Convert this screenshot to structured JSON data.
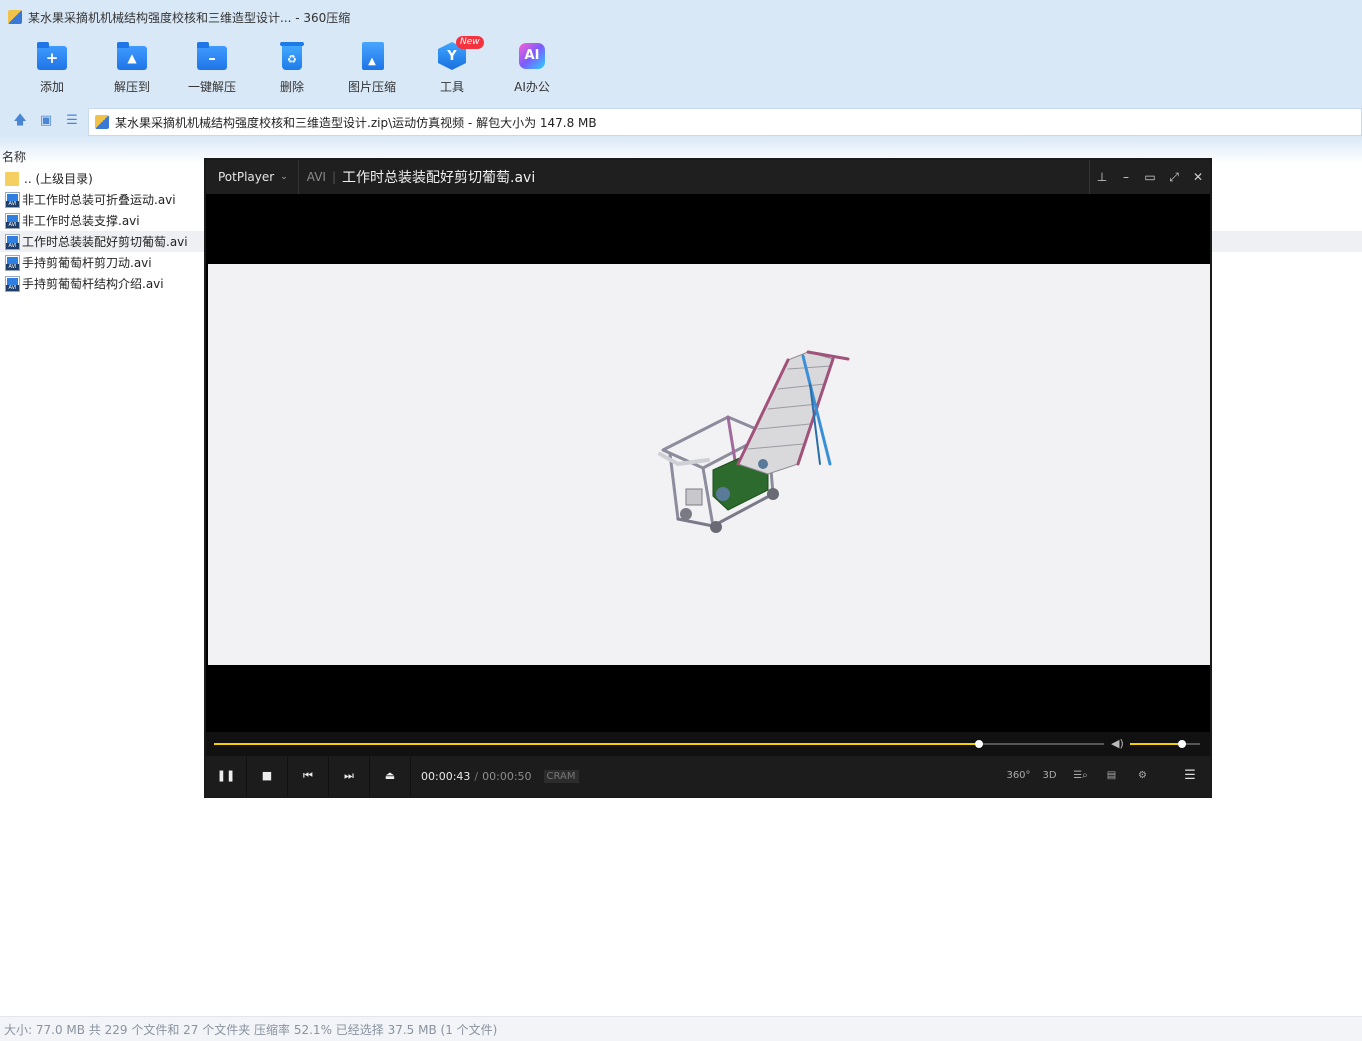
{
  "window": {
    "title": "某水果采摘机机械结构强度校核和三维造型设计... - 360压缩"
  },
  "toolbar": {
    "items": [
      {
        "label": "添加",
        "icon": "add-icon"
      },
      {
        "label": "解压到",
        "icon": "extract-to-icon"
      },
      {
        "label": "一键解压",
        "icon": "one-click-extract-icon"
      },
      {
        "label": "删除",
        "icon": "delete-icon"
      },
      {
        "label": "图片压缩",
        "icon": "image-compress-icon"
      },
      {
        "label": "工具",
        "icon": "tools-icon",
        "badge": "New"
      },
      {
        "label": "AI办公",
        "icon": "ai-office-icon",
        "glyph": "AI"
      }
    ]
  },
  "address": {
    "path": "某水果采摘机机械结构强度校核和三维造型设计.zip\\运动仿真视频 - 解包大小为 147.8 MB"
  },
  "filelist": {
    "column_name": "名称",
    "rows": [
      {
        "name": ".. (上级目录)",
        "type": "parent",
        "selected": false
      },
      {
        "name": "非工作时总装可折叠运动.avi",
        "type": "avi",
        "selected": false
      },
      {
        "name": "非工作时总装支撑.avi",
        "type": "avi",
        "selected": false
      },
      {
        "name": "工作时总装装配好剪切葡萄.avi",
        "type": "avi",
        "selected": true
      },
      {
        "name": "手持剪葡萄杆剪刀动.avi",
        "type": "avi",
        "selected": false
      },
      {
        "name": "手持剪葡萄杆结构介绍.avi",
        "type": "avi",
        "selected": false
      }
    ]
  },
  "status": {
    "text": "大小: 77.0 MB 共 229 个文件和 27 个文件夹 压缩率 52.1% 已经选择 37.5 MB (1 个文件)"
  },
  "player": {
    "brand": "PotPlayer",
    "format": "AVI",
    "divider": "|",
    "filename": "工作时总装装配好剪切葡萄.avi",
    "time_current": "00:00:43",
    "time_separator": "/",
    "time_total": "00:00:50",
    "codec": "CRAM",
    "progress_fraction": 0.86,
    "volume_fraction": 0.74,
    "right_buttons": [
      "360°",
      "3D"
    ],
    "colors": {
      "accent": "#f5d000"
    }
  }
}
